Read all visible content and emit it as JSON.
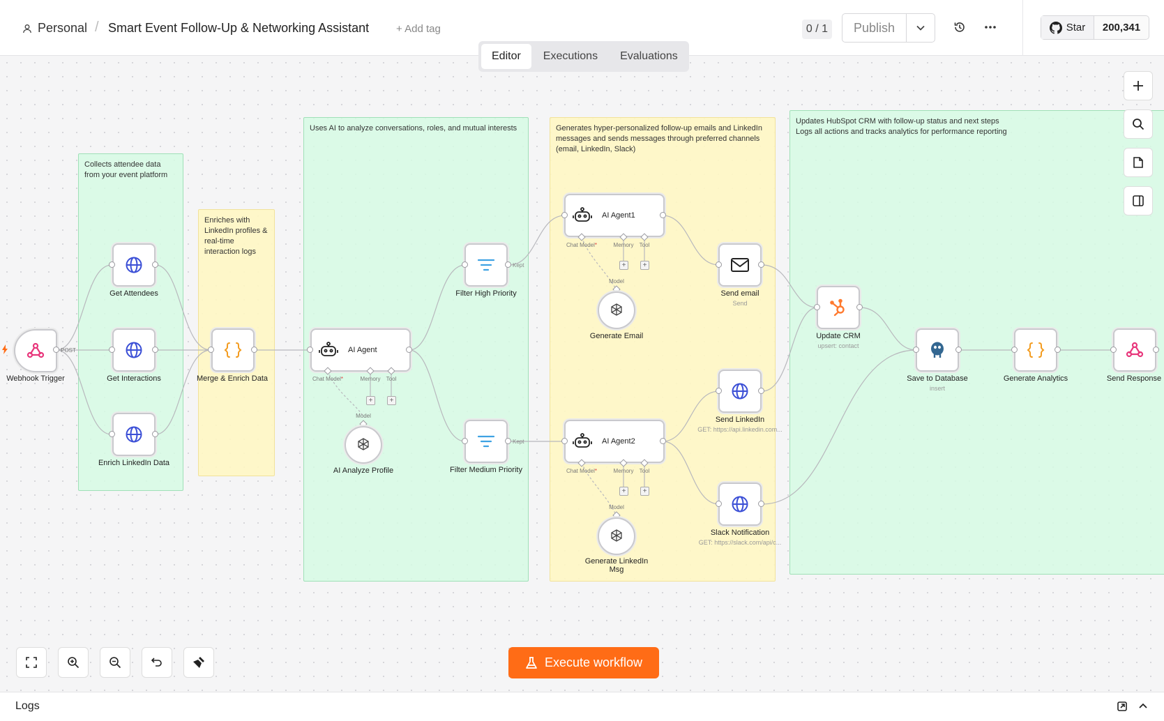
{
  "header": {
    "project": "Personal",
    "separator": "/",
    "workflow_title": "Smart Event Follow-Up & Networking Assistant",
    "add_tag": "+ Add tag",
    "version_counter": "0 / 1",
    "publish_label": "Publish",
    "github_star_label": "Star",
    "github_star_count": "200,341"
  },
  "tabs": [
    {
      "label": "Editor",
      "active": true
    },
    {
      "label": "Executions",
      "active": false
    },
    {
      "label": "Evaluations",
      "active": false
    }
  ],
  "sticky_notes": {
    "collect": "Collects attendee data from your event platform",
    "enrich": "Enriches with LinkedIn profiles & real-time interaction logs",
    "analyze": "Uses AI to analyze conversations, roles, and mutual interests",
    "generate": "Generates hyper-personalized follow-up emails and LinkedIn messages and sends messages through preferred channels (email, LinkedIn, Slack)",
    "update": "Updates HubSpot CRM with follow-up status and next steps\nLogs all actions and tracks analytics for performance reporting"
  },
  "nodes": {
    "webhook_trigger": {
      "label": "Webhook Trigger",
      "port": "POST"
    },
    "get_attendees": {
      "label": "Get Attendees"
    },
    "get_interactions": {
      "label": "Get Interactions"
    },
    "enrich_linkedin": {
      "label": "Enrich LinkedIn Data"
    },
    "merge_enrich": {
      "label": "Merge & Enrich Data"
    },
    "ai_agent": {
      "label": "AI Agent"
    },
    "ai_analyze_profile": {
      "label": "AI Analyze Profile"
    },
    "filter_high": {
      "label": "Filter High Priority",
      "port": "Kept"
    },
    "filter_medium": {
      "label": "Filter Medium Priority",
      "port": "Kept"
    },
    "ai_agent1": {
      "label": "AI Agent1"
    },
    "ai_agent2": {
      "label": "AI Agent2"
    },
    "generate_email": {
      "label": "Generate Email"
    },
    "generate_linkedin": {
      "label": "Generate LinkedIn Msg"
    },
    "send_email": {
      "label": "Send email",
      "sub": "Send"
    },
    "send_linkedin": {
      "label": "Send LinkedIn",
      "sub": "GET: https://api.linkedin.com..."
    },
    "slack_notification": {
      "label": "Slack Notification",
      "sub": "GET: https://slack.com/api/c..."
    },
    "update_crm": {
      "label": "Update CRM",
      "sub": "upsert: contact"
    },
    "save_database": {
      "label": "Save to Database",
      "sub": "insert"
    },
    "generate_analytics": {
      "label": "Generate Analytics"
    },
    "send_response": {
      "label": "Send Response"
    }
  },
  "ports": {
    "chat_model": "Chat Model",
    "required_mark": "*",
    "memory": "Memory",
    "tool": "Tool",
    "model": "Model",
    "plus": "+"
  },
  "bottom": {
    "execute_label": "Execute workflow"
  },
  "logs": {
    "title": "Logs"
  },
  "colors": {
    "accent": "#ff6c16",
    "webhook": "#e8367b",
    "globe": "#3b4fd6",
    "code": "#f39b1e",
    "filter": "#3fa2e3",
    "hubspot": "#ff7a2f",
    "postgres": "#336791",
    "sticky_green": "#d6fae4",
    "sticky_yellow": "#fff7c4"
  }
}
